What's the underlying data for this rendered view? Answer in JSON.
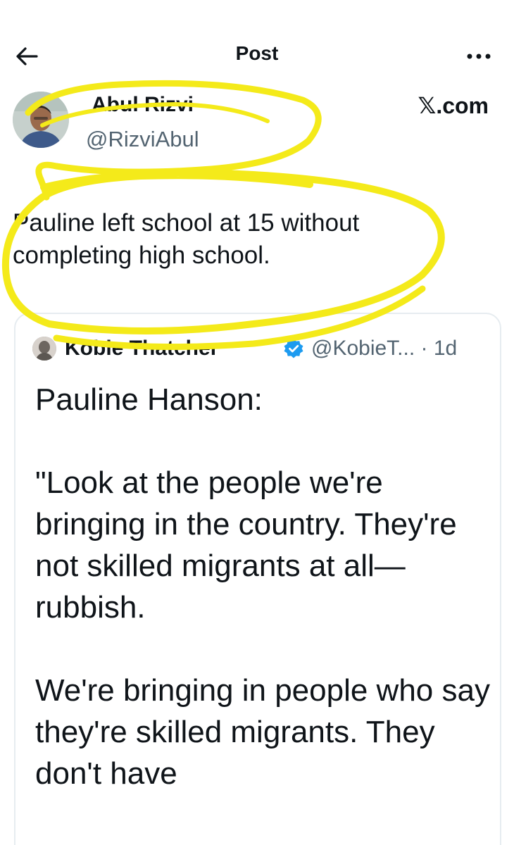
{
  "header": {
    "title": "Post",
    "back_icon": "arrow-left-icon",
    "more_icon": "more-horizontal-icon"
  },
  "author": {
    "name": "Abul Rizvi",
    "handle": "@RizviAbul",
    "brand": "𝕏.com"
  },
  "tweet": {
    "text": "Pauline left school at 15 without completing high school."
  },
  "quoted_tweet": {
    "name": "Kobie Thatcher",
    "handle": "@KobieT... · 1d",
    "verified": true,
    "body": "Pauline Hanson:\n\n\"Look at the people we're bringing in the country. They're not skilled migrants at all—rubbish.\n\nWe're bringing in people who say they're skilled migrants. They don't have"
  },
  "colors": {
    "highlight": "#f4ea1a",
    "verified_blue": "#1d9bf0",
    "secondary_text": "#536471"
  }
}
